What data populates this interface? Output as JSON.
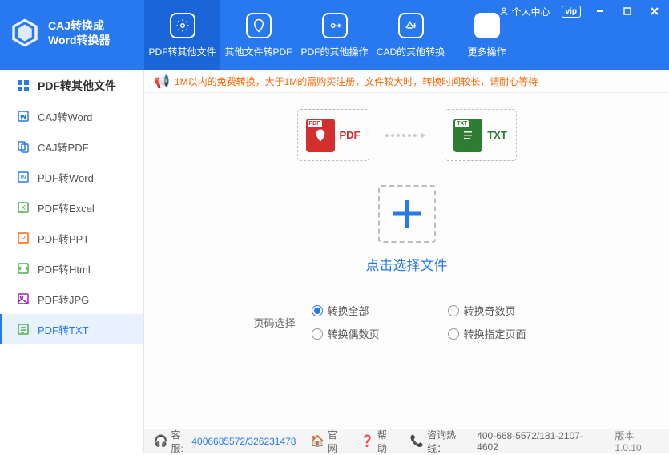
{
  "app": {
    "title_line1": "CAJ转换成",
    "title_line2": "Word转换器"
  },
  "window_controls": {
    "user_center": "个人中心",
    "vip": "vip"
  },
  "tabs": [
    {
      "label": "PDF转其他文件",
      "active": true
    },
    {
      "label": "其他文件转PDF",
      "active": false
    },
    {
      "label": "PDF的其他操作",
      "active": false
    },
    {
      "label": "CAD的其他转换",
      "active": false
    },
    {
      "label": "更多操作",
      "active": false
    }
  ],
  "sidebar": {
    "section": "PDF转其他文件",
    "items": [
      {
        "label": "CAJ转Word",
        "icon_color": "#2879f0"
      },
      {
        "label": "CAJ转PDF",
        "icon_color": "#2879f0"
      },
      {
        "label": "PDF转Word",
        "icon_color": "#2879f0"
      },
      {
        "label": "PDF转Excel",
        "icon_color": "#4caf50"
      },
      {
        "label": "PDF转PPT",
        "icon_color": "#ff6600"
      },
      {
        "label": "PDF转Html",
        "icon_color": "#4caf50"
      },
      {
        "label": "PDF转JPG",
        "icon_color": "#9c27b0"
      },
      {
        "label": "PDF转TXT",
        "icon_color": "#4caf50",
        "active": true
      }
    ]
  },
  "notice": "1M以内的免费转换，大于1M的需购买注册，文件较大时，转换时间较长，请耐心等待",
  "conversion": {
    "from_badge": "PDF",
    "from_label": "PDF",
    "to_badge": "TXT",
    "to_label": "TXT"
  },
  "drop": {
    "text": "点击选择文件"
  },
  "options": {
    "label": "页码选择",
    "items": [
      "转换全部",
      "转换奇数页",
      "转换偶数页",
      "转换指定页面"
    ],
    "selected": 0
  },
  "statusbar": {
    "kefu_label": "客服:",
    "kefu_value": "4006685572/326231478",
    "guanwang": "官网",
    "bangzhu": "帮助",
    "hotline_label": "咨询热线：",
    "hotline_value": "400-668-5572/181-2107-4602",
    "version": "版本1.0.10"
  }
}
